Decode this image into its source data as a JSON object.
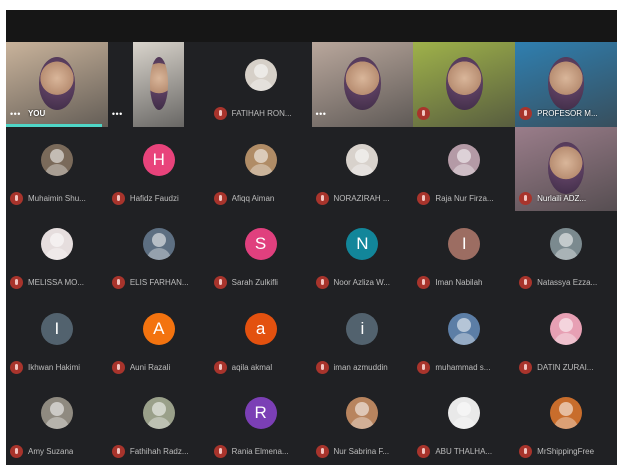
{
  "colors": {
    "background": "#202124",
    "mic_muted": "#a8342c",
    "active_speaker": "#4fd6c7"
  },
  "icons": {
    "mic": "mic-off-icon",
    "more": "more-options-icon"
  },
  "participants": [
    {
      "name": "YOU",
      "type": "video",
      "color": "#c9b39b",
      "more": "•••"
    },
    {
      "name": "",
      "type": "video",
      "color": "#d9d4cc",
      "more": "•••"
    },
    {
      "name": "FATIHAH RON...",
      "type": "avatar-photo",
      "color": "#d6d0c8"
    },
    {
      "name": "",
      "type": "video",
      "color": "#b9a79c",
      "more": "•••"
    },
    {
      "name": "",
      "type": "video",
      "color": "#9fb24a"
    },
    {
      "name": "PROFESOR M...",
      "type": "video",
      "color": "#2f7fb0"
    },
    {
      "name": "Muhaimin Shu...",
      "type": "avatar-photo",
      "color": "#7a6a5a"
    },
    {
      "name": "Hafidz Faudzi",
      "type": "avatar-letter",
      "letter": "H",
      "color": "#e8437b"
    },
    {
      "name": "Afiqq Aiman",
      "type": "avatar-photo",
      "color": "#b08c66"
    },
    {
      "name": "NORAZIRAH ...",
      "type": "avatar-photo",
      "color": "#d8d2cc"
    },
    {
      "name": "Raja Nur Firza...",
      "type": "avatar-photo",
      "color": "#b49aa6"
    },
    {
      "name": "Nurlaili ADZ...",
      "type": "video",
      "color": "#9a7d8a"
    },
    {
      "name": "MELISSA MO...",
      "type": "avatar-photo",
      "color": "#e6dede"
    },
    {
      "name": "ELIS FARHAN...",
      "type": "avatar-photo",
      "color": "#5d6f82"
    },
    {
      "name": "Sarah Zulkifli",
      "type": "avatar-letter",
      "letter": "S",
      "color": "#e0407e"
    },
    {
      "name": "Noor Azliza W...",
      "type": "avatar-letter",
      "letter": "N",
      "color": "#12869a"
    },
    {
      "name": "Iman Nabilah",
      "type": "avatar-letter",
      "letter": "I",
      "color": "#9c6d62"
    },
    {
      "name": "Natassya Ezza...",
      "type": "avatar-photo",
      "color": "#7b8a8f"
    },
    {
      "name": "Ikhwan Hakimi",
      "type": "avatar-letter",
      "letter": "I",
      "color": "#52626e"
    },
    {
      "name": "Auni Razali",
      "type": "avatar-letter",
      "letter": "A",
      "color": "#f3730f"
    },
    {
      "name": "aqila akmal",
      "type": "avatar-letter",
      "letter": "a",
      "color": "#e3510f"
    },
    {
      "name": "iman azmuddin",
      "type": "avatar-letter",
      "letter": "i",
      "color": "#52626e"
    },
    {
      "name": "muhammad s...",
      "type": "avatar-photo",
      "color": "#5c7ea6"
    },
    {
      "name": "DATIN ZURAI...",
      "type": "avatar-photo",
      "color": "#e7a0b4"
    },
    {
      "name": "Amy Suzana",
      "type": "avatar-photo",
      "color": "#8f8a80"
    },
    {
      "name": "Fathihah Radz...",
      "type": "avatar-photo",
      "color": "#9aa08a"
    },
    {
      "name": "Rania Elmena...",
      "type": "avatar-letter",
      "letter": "R",
      "color": "#7b3fb5"
    },
    {
      "name": "Nur Sabrina F...",
      "type": "avatar-photo",
      "color": "#b8845e"
    },
    {
      "name": "ABU THALHA...",
      "type": "avatar-photo",
      "color": "#e9e9e9"
    },
    {
      "name": "MrShippingFree",
      "type": "avatar-photo",
      "color": "#c86d2c"
    }
  ]
}
